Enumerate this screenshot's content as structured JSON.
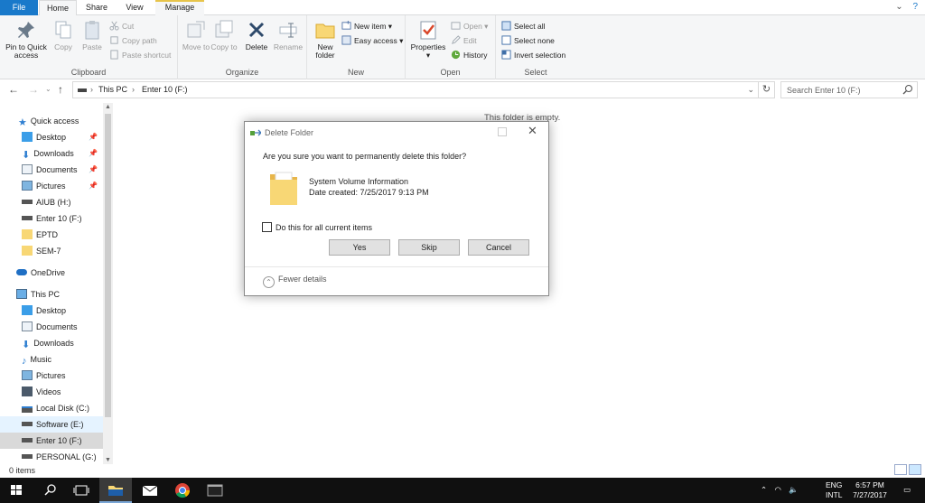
{
  "tabs": {
    "file": "File",
    "home": "Home",
    "share": "Share",
    "view": "View",
    "manage": "Manage"
  },
  "ribbon": {
    "clipboard": {
      "label": "Clipboard",
      "pin": "Pin to Quick access",
      "copy": "Copy",
      "paste": "Paste",
      "cut": "Cut",
      "copy_path": "Copy path",
      "paste_shortcut": "Paste shortcut"
    },
    "organize": {
      "label": "Organize",
      "move_to": "Move to",
      "copy_to": "Copy to",
      "delete": "Delete",
      "rename": "Rename"
    },
    "new": {
      "label": "New",
      "new_folder": "New folder",
      "new_item": "New item",
      "easy_access": "Easy access"
    },
    "open": {
      "label": "Open",
      "properties": "Properties",
      "open": "Open",
      "edit": "Edit",
      "history": "History"
    },
    "select": {
      "label": "Select",
      "select_all": "Select all",
      "select_none": "Select none",
      "invert": "Invert selection"
    }
  },
  "address": {
    "crumbs": [
      "This PC",
      "Enter 10 (F:)"
    ],
    "search_placeholder": "Search Enter 10 (F:)"
  },
  "navpane": {
    "quick_access": "Quick access",
    "quick_items": [
      "Desktop",
      "Downloads",
      "Documents",
      "Pictures",
      "AIUB (H:)",
      "Enter 10 (F:)",
      "EPTD",
      "SEM-7"
    ],
    "onedrive": "OneDrive",
    "this_pc": "This PC",
    "pc_items": [
      "Desktop",
      "Documents",
      "Downloads",
      "Music",
      "Pictures",
      "Videos",
      "Local Disk (C:)",
      "Software (E:)",
      "Enter 10 (F:)",
      "PERSONAL (G:)"
    ]
  },
  "content": {
    "empty": "This folder is empty."
  },
  "status": {
    "items": "0 items"
  },
  "dialog": {
    "title": "Delete Folder",
    "question": "Are you sure you want to permanently delete this folder?",
    "folder_name": "System Volume Information",
    "date_created": "Date created: 7/25/2017 9:13 PM",
    "checkbox": "Do this for all current items",
    "yes": "Yes",
    "skip": "Skip",
    "cancel": "Cancel",
    "fewer": "Fewer details"
  },
  "taskbar": {
    "lang": "ENG",
    "layout": "INTL",
    "time": "6:57 PM",
    "date": "7/27/2017"
  },
  "colors": {
    "accent": "#1979ca",
    "selection": "#cce8ff",
    "folder": "#f8d775"
  }
}
